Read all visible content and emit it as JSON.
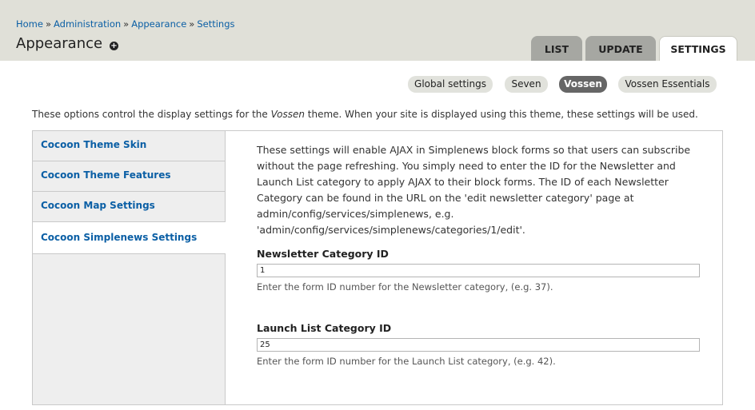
{
  "breadcrumb": {
    "items": [
      "Home",
      "Administration",
      "Appearance",
      "Settings"
    ],
    "separator": "»"
  },
  "page": {
    "title": "Appearance",
    "add_shortcut_icon": "plus-circle-icon"
  },
  "primary_tabs": [
    {
      "label": "LIST",
      "active": false
    },
    {
      "label": "UPDATE",
      "active": false
    },
    {
      "label": "SETTINGS",
      "active": true
    }
  ],
  "secondary_tabs": [
    {
      "label": "Global settings",
      "active": false
    },
    {
      "label": "Seven",
      "active": false
    },
    {
      "label": "Vossen",
      "active": true
    },
    {
      "label": "Vossen Essentials",
      "active": false
    }
  ],
  "description": {
    "before": "These options control the display settings for the ",
    "theme_name": "Vossen",
    "after": " theme. When your site is displayed using this theme, these settings will be used."
  },
  "vertical_tabs": [
    {
      "label": "Cocoon Theme Skin",
      "selected": false
    },
    {
      "label": "Cocoon Theme Features",
      "selected": false
    },
    {
      "label": "Cocoon Map Settings",
      "selected": false
    },
    {
      "label": "Cocoon Simplenews Settings",
      "selected": true
    }
  ],
  "pane": {
    "help_lines": [
      "These settings will enable AJAX in Simplenews block forms so that users can subscribe",
      "without the page refreshing. You simply need to enter the ID for the Newsletter and",
      "Launch List category to apply AJAX to their block forms. The ID of each Newsletter",
      "Category can be found in the URL on the 'edit newsletter category' page at",
      "admin/config/services/simplenews, e.g.",
      "'admin/config/services/simplenews/categories/1/edit'."
    ],
    "newsletter": {
      "label": "Newsletter Category ID",
      "value": "1",
      "description": "Enter the form ID number for the Newsletter category, (e.g. 37)."
    },
    "launch": {
      "label": "Launch List Category ID",
      "value": "25",
      "description": "Enter the form ID number for the Launch List category, (e.g. 42)."
    }
  },
  "colors": {
    "link": "#0b5fa5",
    "header_bg": "#e0e0d8",
    "active_pill": "#666666"
  }
}
